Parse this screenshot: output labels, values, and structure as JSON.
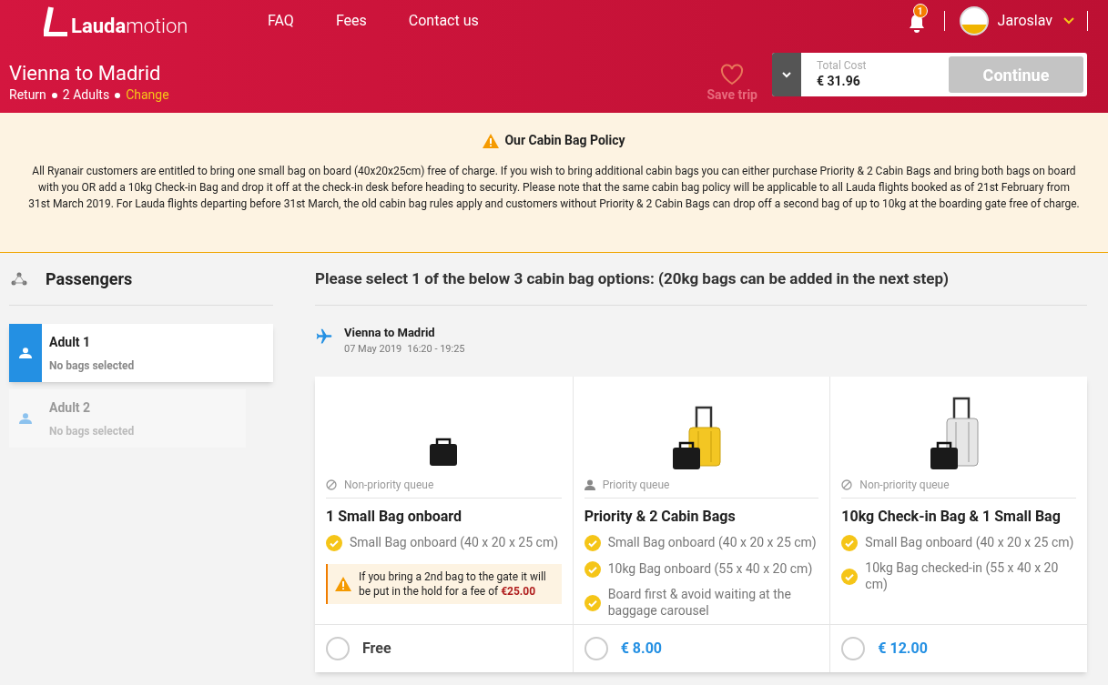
{
  "header": {
    "logo_bold": "Lauda",
    "logo_light": "motion",
    "nav": [
      "FAQ",
      "Fees",
      "Contact us"
    ],
    "notification_count": "1",
    "user": "Jaroslav"
  },
  "trip": {
    "title": "Vienna to Madrid",
    "details": [
      "Return",
      "2 Adults"
    ],
    "change": "Change",
    "save_trip": "Save trip",
    "total_label": "Total Cost",
    "total": "€ 31.96",
    "continue": "Continue",
    "continue_disabled": true
  },
  "policy": {
    "title": "Our Cabin Bag Policy",
    "text": "All Ryanair customers are entitled to bring one small bag on board (40x20x25cm) free of charge. If you wish to bring additional cabin bags you can either purchase Priority & 2 Cabin Bags and bring both bags on board with you OR add a 10kg Check-in Bag and drop it off at the check-in desk before heading to security. Please note that the same cabin bag policy will be applicable to all Lauda flights booked as of 21st February from 31st March 2019. For Lauda flights departing before 31st March, the old cabin bag rules apply and customers without Priority & 2 Cabin Bags can drop off a second bag of up to 10kg at the boarding gate free of charge."
  },
  "passengers": {
    "title": "Passengers",
    "items": [
      {
        "name": "Adult 1",
        "status": "No bags selected",
        "selected": true
      },
      {
        "name": "Adult 2",
        "status": "No bags selected",
        "selected": false
      }
    ]
  },
  "options": {
    "heading": "Please select 1 of the below 3 cabin bag options: (20kg bags can be added in the next step)",
    "flight": {
      "route": "Vienna to Madrid",
      "date": "07 May 2019",
      "time": "16:20 - 19:25"
    },
    "cards": [
      {
        "kind": "small",
        "queue": {
          "kind": "non-priority",
          "label": "Non-priority queue"
        },
        "title": "1 Small Bag onboard",
        "features": [
          "Small Bag onboard (40 x 20 x 25 cm)"
        ],
        "warning": "If you bring a 2nd bag to the gate it will be put in the hold for a fee of **€25.00**",
        "price": {
          "kind": "free",
          "text": "Free"
        },
        "selected": false
      },
      {
        "kind": "yellow",
        "queue": {
          "kind": "priority",
          "label": "Priority queue"
        },
        "title": "Priority & 2 Cabin Bags",
        "features": [
          "Small Bag onboard (40 x 20 x 25 cm)",
          "10kg Bag onboard (55 x 40 x 20 cm)",
          "Board first & avoid waiting at the baggage carousel"
        ],
        "price": {
          "kind": "paid",
          "text": "€ 8.00"
        },
        "selected": false
      },
      {
        "kind": "silver",
        "queue": {
          "kind": "non-priority",
          "label": "Non-priority queue"
        },
        "title": "10kg Check-in Bag & 1 Small Bag",
        "features": [
          "Small Bag onboard (40 x 20 x 25 cm)",
          "10kg Bag checked-in (55 x 40 x 20 cm)"
        ],
        "price": {
          "kind": "paid",
          "text": "€ 12.00"
        },
        "selected": false
      }
    ]
  }
}
